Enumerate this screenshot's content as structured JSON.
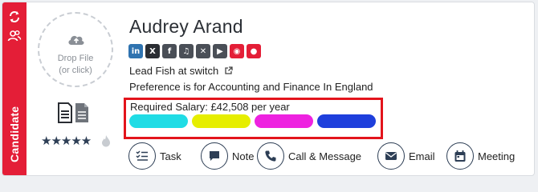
{
  "sidebar": {
    "label": "Candidate",
    "icons": [
      "refresh-icon",
      "people-icon"
    ],
    "color": "#e41e37"
  },
  "dropzone": {
    "line1": "Drop File",
    "line2": "(or click)",
    "icon": "cloud-upload-icon"
  },
  "rating": {
    "stars_text": "★★★★★",
    "value": 5,
    "max": 5
  },
  "candidate": {
    "name": "Audrey Arand",
    "role": "Lead Fish at switch",
    "preference_prefix": "Preference is for ",
    "preference_value": "Accounting and Finance In England",
    "salary_label": "Required Salary: ",
    "salary_value": "£42,508 per year"
  },
  "socials": [
    {
      "name": "linkedin-icon",
      "glyph": "in",
      "color": "#2f73b0"
    },
    {
      "name": "x-icon",
      "glyph": "X",
      "color": "#2a2d33"
    },
    {
      "name": "facebook-icon",
      "glyph": "f",
      "color": "#4a4f57"
    },
    {
      "name": "headphones-icon",
      "glyph": "♫",
      "color": "#4a4f57"
    },
    {
      "name": "xing-icon",
      "glyph": "✕",
      "color": "#4a4f57"
    },
    {
      "name": "play-icon",
      "glyph": "▶",
      "color": "#4a4f57"
    },
    {
      "name": "globe-icon",
      "glyph": "◉",
      "color": "#e41e37"
    },
    {
      "name": "location-pin-icon",
      "glyph": "●",
      "color": "#e41e37"
    }
  ],
  "tags": [
    {
      "color": "#20dce5"
    },
    {
      "color": "#e6ee00"
    },
    {
      "color": "#ee22e0"
    },
    {
      "color": "#1e3fdc"
    }
  ],
  "actions": {
    "task": "Task",
    "note": "Note",
    "call": "Call & Message",
    "email": "Email",
    "meeting": "Meeting"
  },
  "colors": {
    "highlight_border": "#e3141c",
    "icon_dark": "#2d3e55"
  }
}
